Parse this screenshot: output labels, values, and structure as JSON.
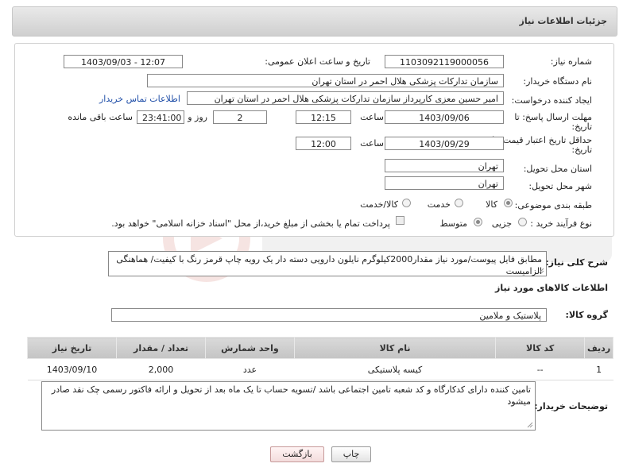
{
  "header": {
    "title": "جزئیات اطلاعات نیاز"
  },
  "form": {
    "need_number_label": "شماره نیاز:",
    "need_number": "1103092119000056",
    "announce_label": "تاریخ و ساعت اعلان عمومی:",
    "announce_value": "1403/09/03 - 12:07",
    "buyer_org_label": "نام دستگاه خریدار:",
    "buyer_org": "سازمان تدارکات پزشکی هلال احمر در استان تهران",
    "requester_label": "ایجاد کننده درخواست:",
    "requester": "امیر حسین معزی کارپرداز سازمان تدارکات پزشکی هلال احمر در استان تهران",
    "contact_link": "اطلاعات تماس خریدار",
    "deadline_label_1": "مهلت ارسال پاسخ: تا",
    "deadline_label_2": "تاریخ:",
    "deadline_date": "1403/09/06",
    "time_label": "ساعت",
    "deadline_time": "12:15",
    "days_value": "2",
    "days_label": "روز و",
    "remaining_time": "23:41:00",
    "remaining_label": "ساعت باقی مانده",
    "validity_label_1": "حداقل تاریخ اعتبار قیمت: تا",
    "validity_label_2": "تاریخ:",
    "validity_date": "1403/09/29",
    "validity_time": "12:00",
    "province_label": "استان محل تحویل:",
    "province": "تهران",
    "city_label": "شهر محل تحویل:",
    "city": "تهران",
    "category_label": "طبقه بندی موضوعی:",
    "category_options": [
      "کالا",
      "خدمت",
      "کالا/خدمت"
    ],
    "process_label": "نوع فرآیند خرید :",
    "process_options": [
      "جزیی",
      "متوسط"
    ],
    "payment_note": "پرداخت تمام یا بخشی از مبلغ خرید،از محل \"اسناد خزانه اسلامی\" خواهد بود."
  },
  "description": {
    "label": "شرح کلی نیاز:",
    "text": "مطابق فایل پیوست/مورد نیاز مقدار2000کیلوگرم نایلون دارویی دسته دار یک رویه چاپ قرمز رنگ با کیفیت/ هماهنگی الزامیست"
  },
  "goods": {
    "section_title": "اطلاعات کالاهای مورد نیاز",
    "group_label": "گروه کالا:",
    "group_value": "پلاستیک و ملامین",
    "columns": [
      "ردیف",
      "کد کالا",
      "نام کالا",
      "واحد شمارش",
      "تعداد / مقدار",
      "تاریخ نیاز"
    ],
    "rows": [
      {
        "row": "1",
        "code": "--",
        "name": "کیسه پلاستیکی",
        "unit": "عدد",
        "qty": "2,000",
        "date": "1403/09/10"
      }
    ]
  },
  "buyer_notes": {
    "label": "توضیحات خریدار:",
    "text": "تامین کننده دارای کدکارگاه و کد شعبه تامین اجتماعی باشد /تسویه حساب تا یک ماه بعد از تحویل و ارائه فاکتور رسمی چک نقد صادر میشود"
  },
  "buttons": {
    "print": "چاپ",
    "back": "بازگشت"
  },
  "colors": {
    "accent_red": "#c0392b",
    "link_blue": "#1f4ea8"
  }
}
